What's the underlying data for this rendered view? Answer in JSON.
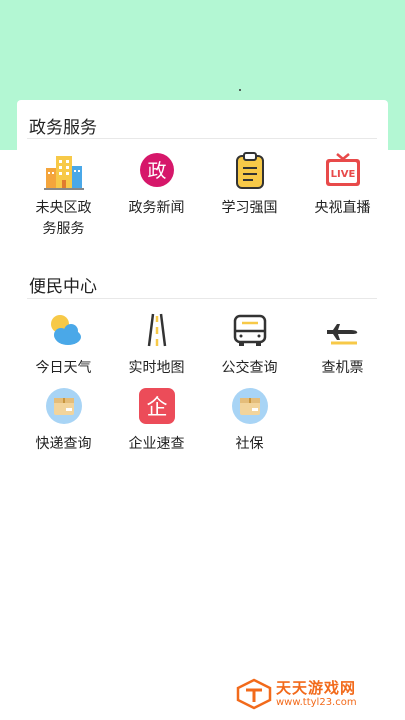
{
  "sections": [
    {
      "title": "政务服务",
      "items": [
        {
          "label": "未央区政务服务",
          "icon": "building-icon"
        },
        {
          "label": "政务新闻",
          "icon": "gov-news-icon",
          "icon_text": "政"
        },
        {
          "label": "学习强国",
          "icon": "clipboard-icon"
        },
        {
          "label": "央视直播",
          "icon": "live-tv-icon",
          "icon_text": "LIVE"
        }
      ]
    },
    {
      "title": "便民中心",
      "items": [
        {
          "label": "今日天气",
          "icon": "weather-icon"
        },
        {
          "label": "实时地图",
          "icon": "road-icon"
        },
        {
          "label": "公交查询",
          "icon": "bus-icon"
        },
        {
          "label": "查机票",
          "icon": "airplane-icon"
        },
        {
          "label": "快递查询",
          "icon": "parcel-icon"
        },
        {
          "label": "企业速查",
          "icon": "enterprise-icon",
          "icon_text": "企"
        },
        {
          "label": "社保",
          "icon": "parcel-icon"
        }
      ]
    }
  ],
  "watermark": {
    "name": "天天游戏网",
    "url": "www.ttyl23.com"
  },
  "colors": {
    "banner": "#b3f7d3",
    "accent_pink": "#d6176a",
    "accent_red": "#e84a4a",
    "watermark": "#f26a1b"
  }
}
